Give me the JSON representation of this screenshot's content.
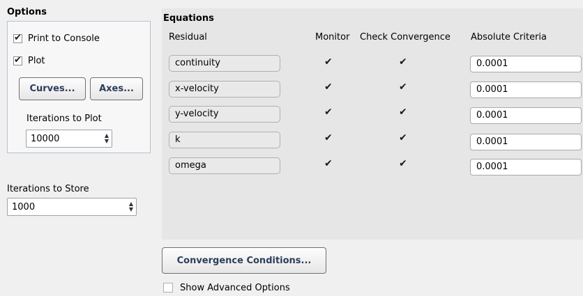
{
  "options": {
    "title": "Options",
    "print_to_console": {
      "label": "Print to Console",
      "checked": true
    },
    "plot": {
      "label": "Plot",
      "checked": true
    },
    "curves_label": "Curves...",
    "axes_label": "Axes...",
    "iterations_to_plot_label": "Iterations to Plot",
    "iterations_to_plot_value": "10000"
  },
  "store": {
    "label": "Iterations to Store",
    "value": "1000"
  },
  "equations": {
    "title": "Equations",
    "headers": {
      "residual": "Residual",
      "monitor": "Monitor",
      "check_convergence": "Check Convergence",
      "absolute_criteria": "Absolute Criteria"
    },
    "rows": [
      {
        "residual": "continuity",
        "monitor": true,
        "check": true,
        "criteria": "0.0001"
      },
      {
        "residual": "x-velocity",
        "monitor": true,
        "check": true,
        "criteria": "0.0001"
      },
      {
        "residual": "y-velocity",
        "monitor": true,
        "check": true,
        "criteria": "0.0001"
      },
      {
        "residual": "k",
        "monitor": true,
        "check": true,
        "criteria": "0.0001"
      },
      {
        "residual": "omega",
        "monitor": true,
        "check": true,
        "criteria": "0.0001"
      }
    ]
  },
  "convergence_conditions_label": "Convergence Conditions...",
  "advanced": {
    "label": "Show Advanced Options",
    "checked": false
  }
}
